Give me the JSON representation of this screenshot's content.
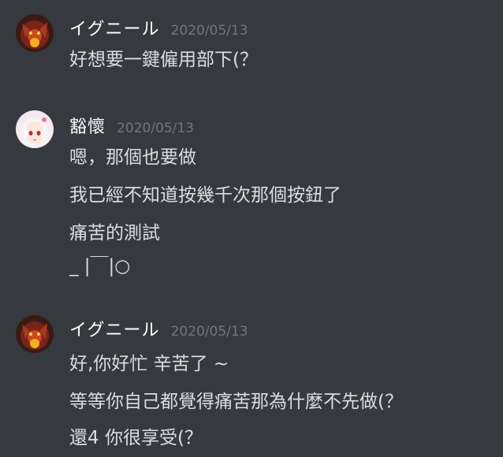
{
  "messages": [
    {
      "username": "イグニール",
      "timestamp": "2020/05/13",
      "avatar": "dark-red-beast-avatar",
      "lines": [
        "好想要一鍵僱用部下(？"
      ]
    },
    {
      "username": "豁懷",
      "timestamp": "2020/05/13",
      "avatar": "anime-girl-avatar",
      "lines": [
        "嗯，那個也要做",
        "我已經不知道按幾千次那個按鈕了",
        "痛苦的測試",
        "_ |￣|○"
      ]
    },
    {
      "username": "イグニール",
      "timestamp": "2020/05/13",
      "avatar": "dark-red-beast-avatar",
      "lines": [
        "好,你好忙 辛苦了 ~",
        "等等你自己都覺得痛苦那為什麼不先做(？",
        "還4 你很享受(？"
      ]
    }
  ],
  "colors": {
    "background": "#36393f",
    "username": "#ffffff",
    "timestamp": "#72767d",
    "text": "#dcddde"
  }
}
